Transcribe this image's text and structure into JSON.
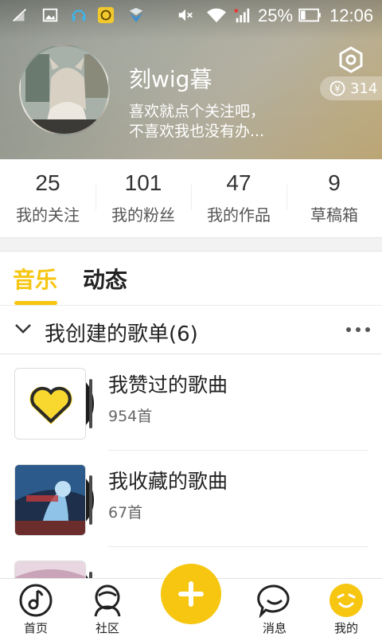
{
  "status_bar": {
    "battery_percent": "25%",
    "time": "12:06",
    "icons": [
      "signal-off-icon",
      "image-icon",
      "headset-icon",
      "app-badge-icon",
      "shield-icon",
      "mute-icon",
      "wifi-icon",
      "cell-signal-icon",
      "battery-icon"
    ]
  },
  "profile": {
    "username": "刻wig暮",
    "bio": "喜欢就点个关注吧，\n不喜欢我也没有办...",
    "coins": "314",
    "coin_symbol": "¥"
  },
  "stats": [
    {
      "value": "25",
      "label": "我的关注"
    },
    {
      "value": "101",
      "label": "我的粉丝"
    },
    {
      "value": "47",
      "label": "我的作品"
    },
    {
      "value": "9",
      "label": "草稿箱"
    }
  ],
  "tabs": [
    {
      "label": "音乐",
      "active": true
    },
    {
      "label": "动态",
      "active": false
    }
  ],
  "section": {
    "title": "我创建的歌单(6)"
  },
  "playlists": [
    {
      "title": "我赞过的歌曲",
      "count": "954首"
    },
    {
      "title": "我收藏的歌曲",
      "count": "67首"
    }
  ],
  "bottom_nav": [
    {
      "label": "首页",
      "icon": "music-disc-icon"
    },
    {
      "label": "社区",
      "icon": "community-icon"
    },
    {
      "label": "消息",
      "icon": "message-icon"
    },
    {
      "label": "我的",
      "icon": "profile-face-icon",
      "active": true
    }
  ],
  "colors": {
    "accent": "#f6c611"
  }
}
